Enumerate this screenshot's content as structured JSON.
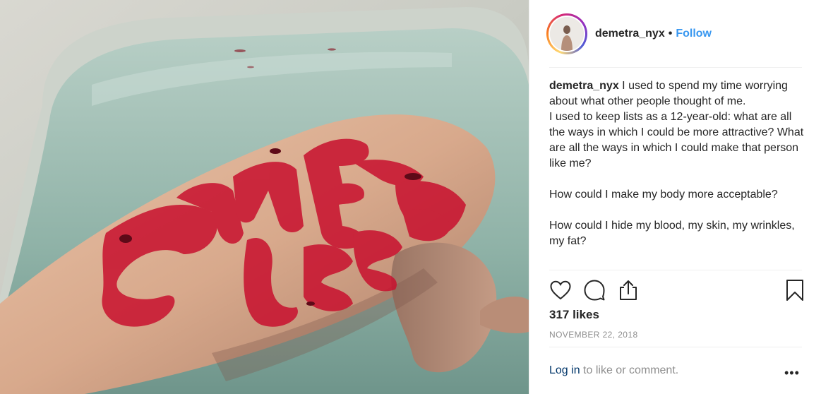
{
  "post": {
    "image_alt": "",
    "header": {
      "username": "demetra_nyx",
      "separator": "•",
      "follow_label": "Follow"
    },
    "caption": {
      "username": "demetra_nyx",
      "line1": "I used to spend my time worrying about what other people thought of me.",
      "line2": "I used to keep lists as a 12-year-old: what are all the ways in which I could be more attractive? What are all the ways in which I could make that person like me?",
      "line3": "How could I make my body more acceptable?",
      "line4": "How could I hide my blood, my skin, my wrinkles, my fat?"
    },
    "actions": {
      "like_icon": "heart-icon",
      "comment_icon": "comment-icon",
      "share_icon": "share-icon",
      "save_icon": "bookmark-icon"
    },
    "likes": "317 likes",
    "date": "NOVEMBER 22, 2018",
    "login": {
      "link_label": "Log in",
      "suffix": "to like or comment."
    },
    "more_label": "•••",
    "colors": {
      "follow": "#3897f0",
      "login_link": "#003569",
      "muted": "#8e8e8e",
      "text": "#262626"
    }
  }
}
